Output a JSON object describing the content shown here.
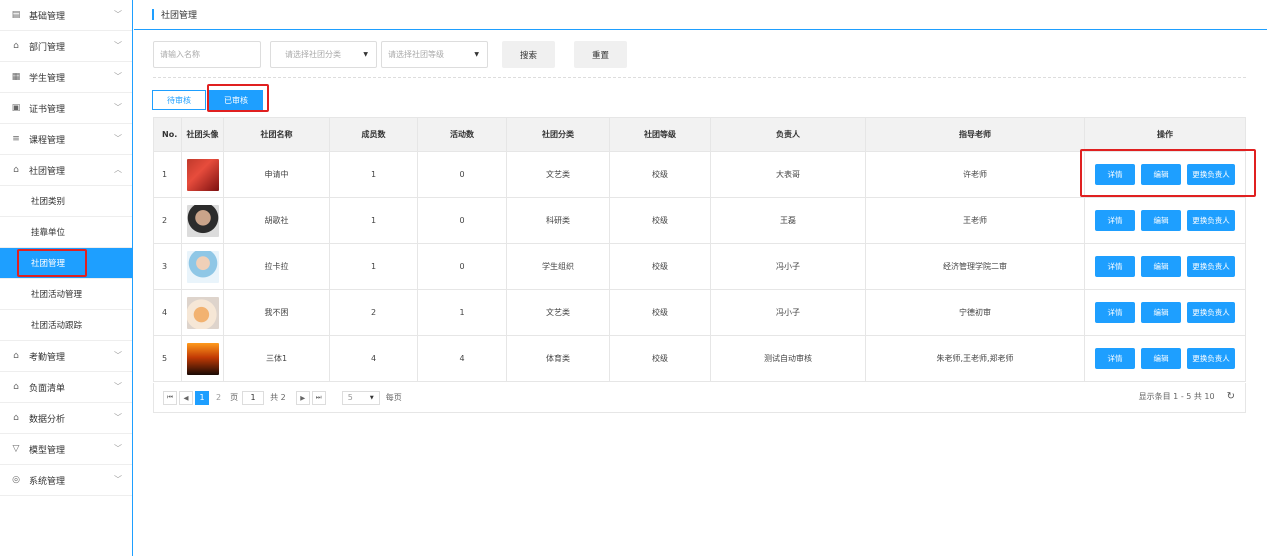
{
  "sidebar": {
    "items": [
      {
        "label": "基础管理",
        "icon": "grid-icon",
        "expanded": false
      },
      {
        "label": "部门管理",
        "icon": "bank-icon",
        "expanded": false
      },
      {
        "label": "学生管理",
        "icon": "student-icon",
        "expanded": false
      },
      {
        "label": "证书管理",
        "icon": "certificate-icon",
        "expanded": false
      },
      {
        "label": "课程管理",
        "icon": "list-icon",
        "expanded": false
      },
      {
        "label": "社团管理",
        "icon": "bank-icon",
        "expanded": true,
        "children": [
          "社团类别",
          "挂靠单位",
          "社团管理",
          "社团活动管理",
          "社团活动跟踪"
        ],
        "active_child": "社团管理"
      },
      {
        "label": "考勤管理",
        "icon": "bank-icon",
        "expanded": false
      },
      {
        "label": "负面清单",
        "icon": "bank-icon",
        "expanded": false
      },
      {
        "label": "数据分析",
        "icon": "bank-icon",
        "expanded": false
      },
      {
        "label": "模型管理",
        "icon": "funnel-icon",
        "expanded": false
      },
      {
        "label": "系统管理",
        "icon": "settings-icon",
        "expanded": false
      }
    ]
  },
  "breadcrumb": "社团管理",
  "filters": {
    "name_placeholder": "请输入名称",
    "category_placeholder": "请选择社团分类",
    "level_placeholder": "请选择社团等级",
    "search_label": "搜索",
    "reset_label": "重置"
  },
  "tabs": [
    {
      "label": "待审核",
      "active": false
    },
    {
      "label": "已审核",
      "active": true
    }
  ],
  "table": {
    "headers": [
      "No.",
      "社团头像",
      "社团名称",
      "成员数",
      "活动数",
      "社团分类",
      "社团等级",
      "负责人",
      "指导老师",
      "操作"
    ],
    "rows": [
      {
        "no": "1",
        "name": "申请中",
        "members": "1",
        "activities": "0",
        "category": "文艺类",
        "level": "校级",
        "leader": "大表哥",
        "teacher": "许老师"
      },
      {
        "no": "2",
        "name": "胡歌社",
        "members": "1",
        "activities": "0",
        "category": "科研类",
        "level": "校级",
        "leader": "王磊",
        "teacher": "王老师"
      },
      {
        "no": "3",
        "name": "拉卡拉",
        "members": "1",
        "activities": "0",
        "category": "学生组织",
        "level": "校级",
        "leader": "冯小子",
        "teacher": "经济管理学院二审"
      },
      {
        "no": "4",
        "name": "我不困",
        "members": "2",
        "activities": "1",
        "category": "文艺类",
        "level": "校级",
        "leader": "冯小子",
        "teacher": "宁德初审"
      },
      {
        "no": "5",
        "name": "三体1",
        "members": "4",
        "activities": "4",
        "category": "体育类",
        "level": "校级",
        "leader": "测试自动审核",
        "teacher": "朱老师,王老师,郑老师"
      }
    ],
    "op_labels": {
      "detail": "详情",
      "edit": "编辑",
      "change_leader": "更换负责人"
    }
  },
  "pagination": {
    "first": "⏮",
    "prev": "◀",
    "page_1": "1",
    "page_2": "2",
    "page_label": "页",
    "current_page": "1",
    "total_pages": "共 2",
    "next": "▶",
    "last": "⏭",
    "page_size": "5",
    "per_page_label": "每页",
    "summary": "显示条目 1 - 5 共 10",
    "refresh": "↻"
  },
  "colors": {
    "accent": "#1e9fff",
    "highlight": "#e02020"
  }
}
